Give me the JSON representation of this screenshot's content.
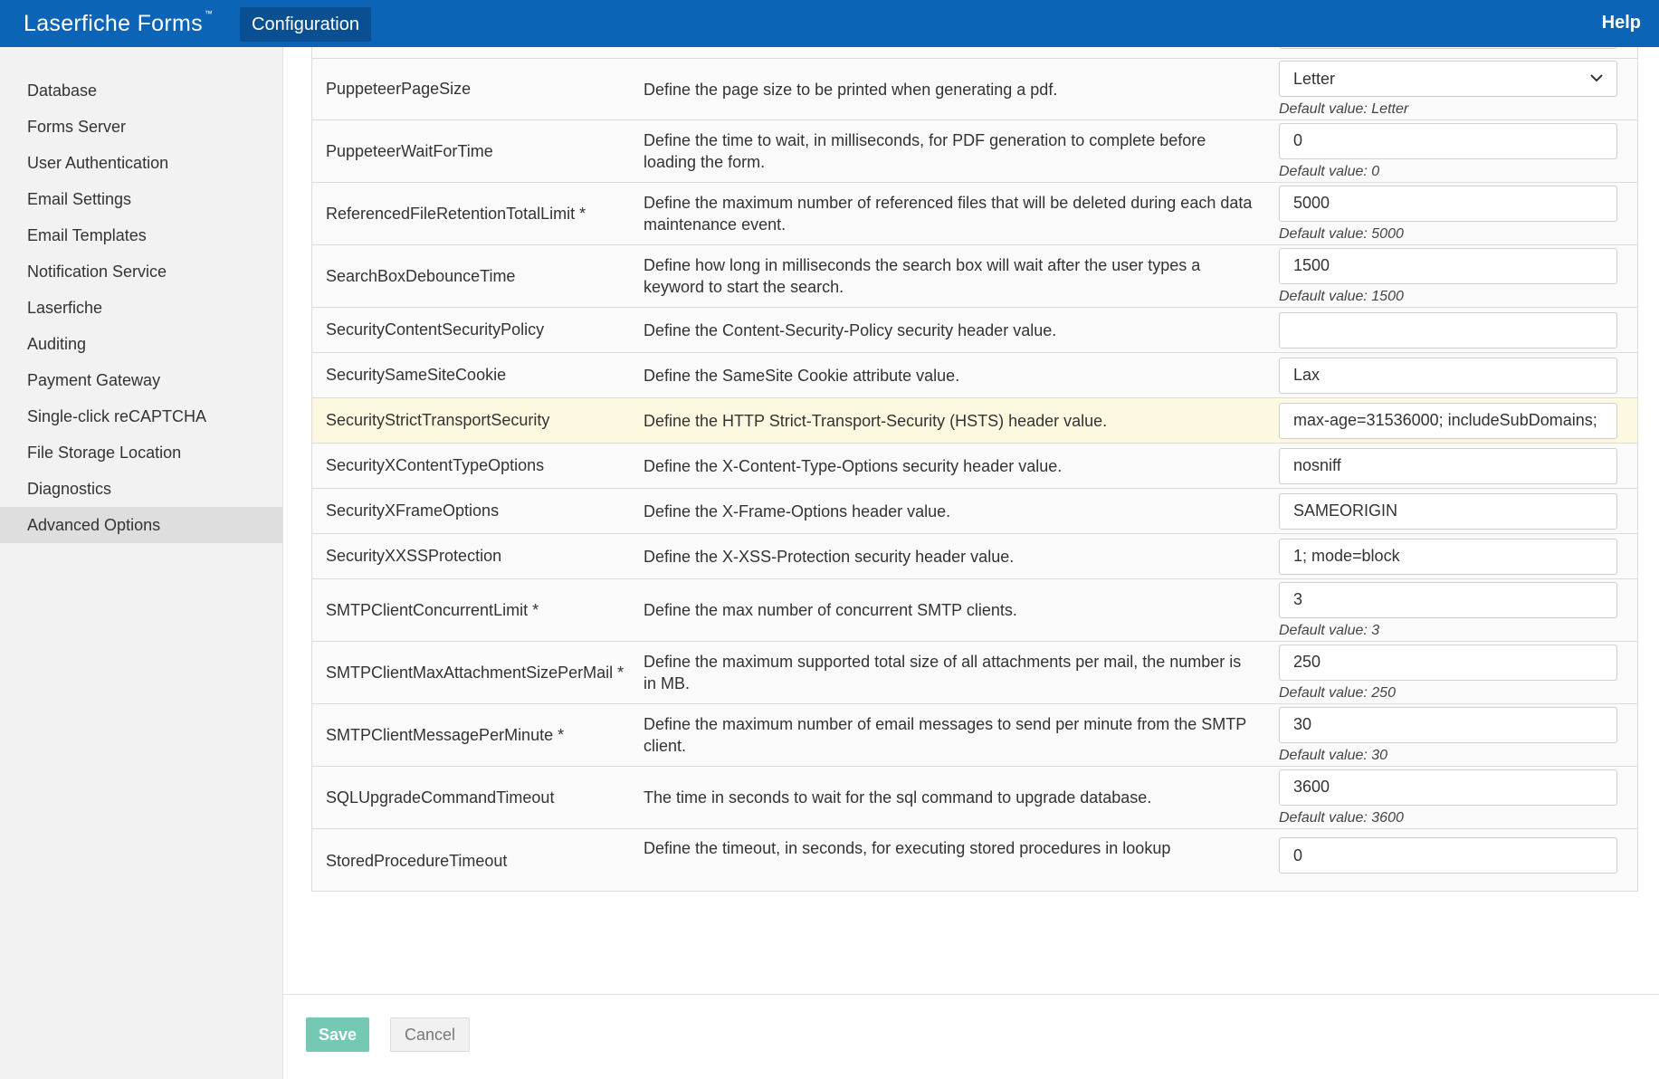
{
  "header": {
    "brand": "Laserfiche Forms",
    "trademark": "™",
    "tab": "Configuration",
    "help": "Help"
  },
  "sidebar": {
    "items": [
      {
        "label": "Database"
      },
      {
        "label": "Forms Server"
      },
      {
        "label": "User Authentication"
      },
      {
        "label": "Email Settings"
      },
      {
        "label": "Email Templates"
      },
      {
        "label": "Notification Service"
      },
      {
        "label": "Laserfiche"
      },
      {
        "label": "Auditing"
      },
      {
        "label": "Payment Gateway"
      },
      {
        "label": "Single-click reCAPTCHA"
      },
      {
        "label": "File Storage Location"
      },
      {
        "label": "Diagnostics"
      },
      {
        "label": "Advanced Options"
      }
    ],
    "active": "Advanced Options"
  },
  "settings": [
    {
      "name": "PuppeteerPageSize",
      "description": "Define the page size to be printed when generating a pdf.",
      "value": "Letter",
      "hint": "Default value: Letter"
    },
    {
      "name": "PuppeteerWaitForTime",
      "description": "Define the time to wait, in milliseconds, for PDF generation to complete before loading the form.",
      "value": "0",
      "hint": "Default value: 0"
    },
    {
      "name": "ReferencedFileRetentionTotalLimit *",
      "description": "Define the maximum number of referenced files that will be deleted during each data maintenance event.",
      "value": "5000",
      "hint": "Default value: 5000"
    },
    {
      "name": "SearchBoxDebounceTime",
      "description": "Define how long in milliseconds the search box will wait after the user types a keyword to start the search.",
      "value": "1500",
      "hint": "Default value: 1500"
    },
    {
      "name": "SecurityContentSecurityPolicy",
      "description": "Define the Content-Security-Policy security header value.",
      "value": ""
    },
    {
      "name": "SecuritySameSiteCookie",
      "description": "Define the SameSite Cookie attribute value.",
      "value": "Lax"
    },
    {
      "name": "SecurityStrictTransportSecurity",
      "description": "Define the HTTP Strict-Transport-Security (HSTS) header value.",
      "value": "max-age=31536000; includeSubDomains;"
    },
    {
      "name": "SecurityXContentTypeOptions",
      "description": "Define the X-Content-Type-Options security header value.",
      "value": "nosniff"
    },
    {
      "name": "SecurityXFrameOptions",
      "description": "Define the X-Frame-Options header value.",
      "value": "SAMEORIGIN"
    },
    {
      "name": "SecurityXXSSProtection",
      "description": "Define the X-XSS-Protection security header value.",
      "value": "1; mode=block"
    },
    {
      "name": "SMTPClientConcurrentLimit *",
      "description": "Define the max number of concurrent SMTP clients.",
      "value": "3",
      "hint": "Default value: 3"
    },
    {
      "name": "SMTPClientMaxAttachmentSizePerMail *",
      "description": "Define the maximum supported total size of all attachments per mail, the number is in MB.",
      "value": "250",
      "hint": "Default value: 250"
    },
    {
      "name": "SMTPClientMessagePerMinute *",
      "description": "Define the maximum number of email messages to send per minute from the SMTP client.",
      "value": "30",
      "hint": "Default value: 30"
    },
    {
      "name": "SQLUpgradeCommandTimeout",
      "description": "The time in seconds to wait for the sql command to upgrade database.",
      "value": "3600",
      "hint": "Default value: 3600"
    },
    {
      "name": "StoredProcedureTimeout",
      "description": "Define the timeout, in seconds, for executing stored procedures in lookup",
      "value": "0"
    }
  ],
  "actions": {
    "save": "Save",
    "cancel": "Cancel"
  }
}
